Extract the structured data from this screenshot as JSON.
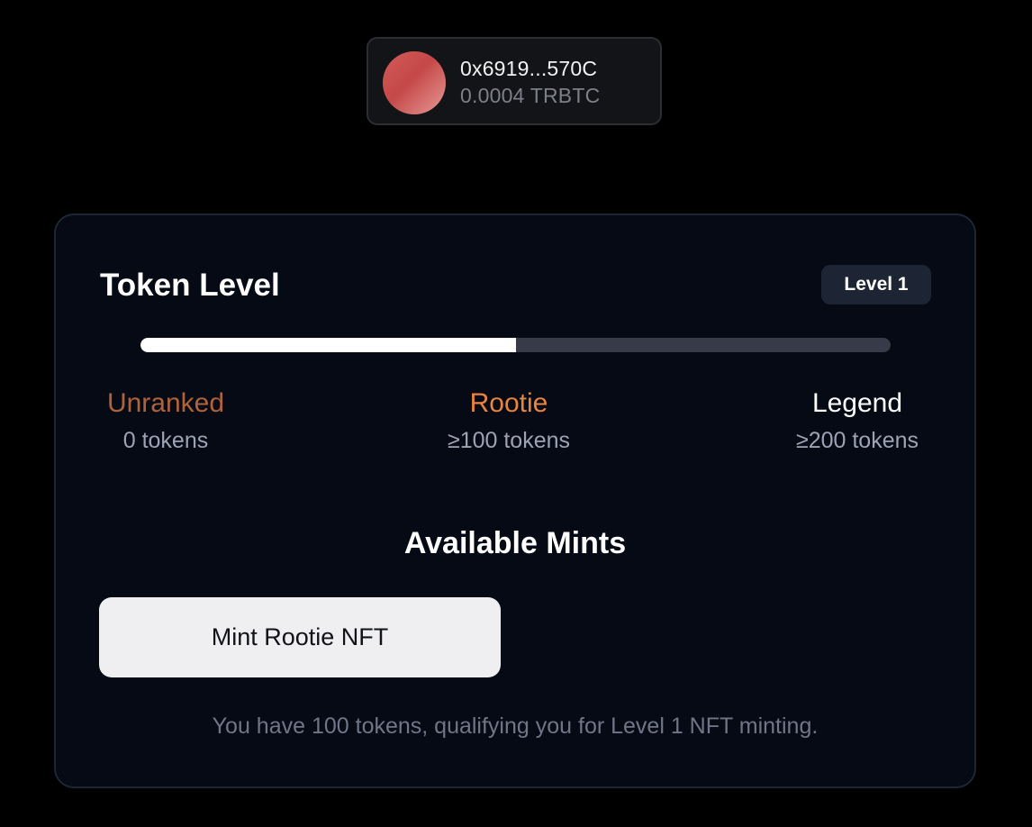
{
  "wallet": {
    "address": "0x6919...570C",
    "balance": "0.0004 TRBTC"
  },
  "card": {
    "title": "Token Level",
    "level_badge": "Level 1",
    "progress": 0.5,
    "tiers": [
      {
        "name": "Unranked",
        "requirement": "0 tokens",
        "color": "#b0633b"
      },
      {
        "name": "Rootie",
        "requirement": "≥100 tokens",
        "color": "#e9843e"
      },
      {
        "name": "Legend",
        "requirement": "≥200 tokens",
        "color": "#ffffff"
      }
    ],
    "mints_title": "Available Mints",
    "mint_button_label": "Mint Rootie NFT",
    "footnote": "You have 100 tokens, qualifying you for Level 1 NFT minting."
  },
  "colors": {
    "background": "#000000",
    "card_background": "#050a15",
    "progress_fill": "#ffffff",
    "progress_track": "#363a49"
  }
}
